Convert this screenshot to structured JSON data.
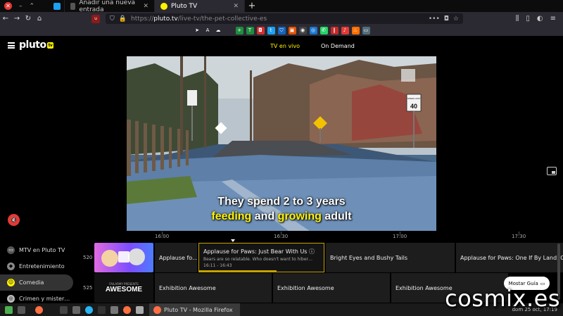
{
  "browser": {
    "tabs": [
      {
        "label": "Añadir una nueva entrada",
        "close": "✕"
      },
      {
        "label": "Pluto TV",
        "close": "✕"
      }
    ],
    "url_domain": "pluto.tv",
    "url_path": "/live-tv/the-pet-collective-es",
    "url_prefix": "https://"
  },
  "pluto": {
    "logo": "pluto",
    "logo_tv": "tv",
    "nav": {
      "live": "TV en vivo",
      "on_demand": "On Demand"
    }
  },
  "video": {
    "caption_line1": "They spend 2 to 3 years",
    "caption_line2_a": "feeding",
    "caption_line2_b": " and ",
    "caption_line2_c": "growing",
    "caption_line2_d": " adult",
    "sign_speed": "40",
    "sign_speed_label": "SPEED LIMIT"
  },
  "guide": {
    "times": [
      "16:00",
      "16:30",
      "17:00",
      "17:30"
    ],
    "categories": [
      {
        "label": "MTV en Pluto TV",
        "color": "#e53935"
      },
      {
        "label": "Entretenimiento",
        "color": "#888"
      },
      {
        "label": "Comedia",
        "color": "#fff200"
      },
      {
        "label": "Crimen y mister…",
        "color": "#bbb"
      }
    ],
    "row1": {
      "channel": "520",
      "programs": [
        "Applause fo…",
        "Bright Eyes and Bushy Tails",
        "Applause for Paws: One If By Land, Ch"
      ],
      "current": {
        "title": "Applause for Paws: Just Bear With Us",
        "desc": "Bears are so relatable. Who doesn't want to hiber…",
        "time": "16:11 - 16:43",
        "progress": 0.62
      }
    },
    "row2": {
      "channel": "525",
      "logo_text": "AWESOME",
      "logo_small": "FAILARMY PRESENTS",
      "programs": [
        "Exhibition Awesome",
        "Exhibition Awesome",
        "Exhibition Awesome"
      ]
    },
    "guide_button": "Mostar Guía"
  },
  "taskbar": {
    "task": "Pluto TV - Mozilla Firefox",
    "clock": "dom 25 oct, 17:19"
  },
  "watermark": "cosmix.es"
}
